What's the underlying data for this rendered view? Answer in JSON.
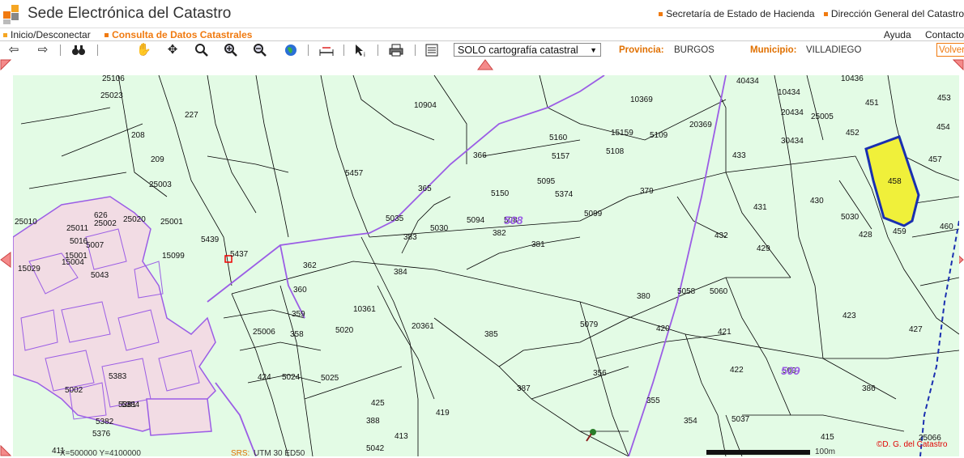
{
  "header": {
    "title": "Sede Electrónica del Catastro",
    "links": [
      "Secretaría de Estado de Hacienda",
      "Dirección General del Catastro"
    ]
  },
  "nav": {
    "items": [
      "Inicio/Desconectar",
      "Consulta de Datos Catastrales"
    ],
    "right_items": [
      "Ayuda",
      "Contacto"
    ]
  },
  "toolbar": {
    "layer_select_value": "SOLO cartografía catastral",
    "provincia_label": "Provincia:",
    "provincia_value": "BURGOS",
    "municipio_label": "Municipio:",
    "municipio_value": "VILLADIEGO",
    "volver_label": "Volver"
  },
  "map": {
    "parcel_labels": [
      "25106",
      "25023",
      "227",
      "10904",
      "10369",
      "40434",
      "10436",
      "451",
      "10434",
      "453",
      "20434",
      "25005",
      "20369",
      "454",
      "5160",
      "15159",
      "5109",
      "452",
      "30434",
      "5157",
      "5108",
      "366",
      "433",
      "457",
      "208",
      "209",
      "5457",
      "365",
      "5150",
      "5095",
      "458",
      "25003",
      "379",
      "25001",
      "5035",
      "508",
      "5094",
      "5099",
      "431",
      "430",
      "5030",
      "460",
      "5030",
      "382",
      "432",
      "428",
      "459",
      "383",
      "381",
      "429",
      "15099",
      "5439",
      "5437",
      "362",
      "384",
      "15029",
      "360",
      "5058",
      "5060",
      "380",
      "359",
      "10361",
      "423",
      "25006",
      "358",
      "20361",
      "385",
      "420",
      "421",
      "5079",
      "427",
      "5020",
      "509",
      "422",
      "424",
      "5024",
      "5025",
      "356",
      "387",
      "386",
      "425",
      "355",
      "419",
      "388",
      "354",
      "5037",
      "415",
      "413",
      "25066",
      "5042",
      "411",
      "5043",
      "626",
      "25002",
      "25020",
      "25010",
      "25011",
      "5016",
      "5007",
      "15004",
      "15001",
      "5002",
      "5383",
      "5384",
      "5381",
      "5382",
      "5376",
      "5374"
    ],
    "polygon_labels": [
      "508",
      "509"
    ],
    "highlighted_parcel": "458",
    "colors": {
      "background": "#e3fbe5",
      "parcel_line": "#000000",
      "polygon_line": "#9b5de5",
      "urban_fill": "#f2dce4",
      "highlight_fill": "#f0f03a",
      "highlight_border": "#1a2fb0",
      "boundary_dash": "#1a2fb0"
    }
  },
  "status": {
    "coords": "X=500000 Y=4100000",
    "srs_label": "SRS:",
    "srs_value": "UTM 30 ED50",
    "scale_label": "100m",
    "copyright": "©D. G. del Catastro"
  },
  "icons": [
    "back-arrow-icon",
    "forward-arrow-icon",
    "binoculars-icon",
    "pan-hand-icon",
    "move-icon",
    "zoom-box-icon",
    "zoom-in-icon",
    "zoom-out-icon",
    "globe-icon",
    "measure-icon",
    "info-pointer-icon",
    "print-icon",
    "list-icon"
  ]
}
